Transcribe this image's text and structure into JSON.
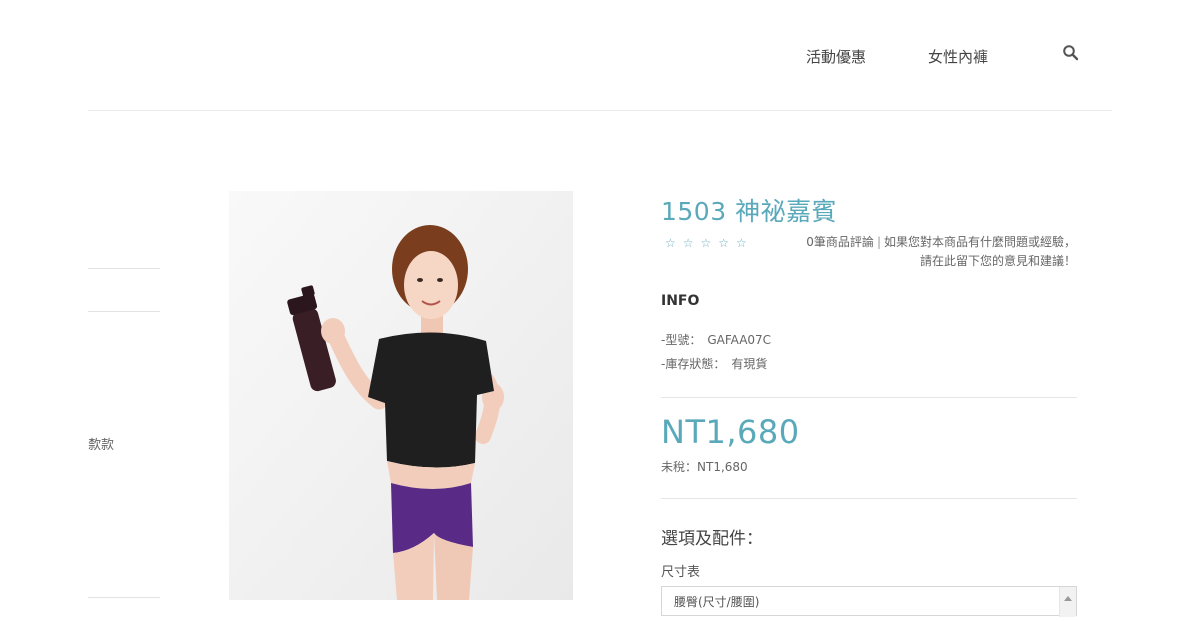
{
  "nav": {
    "items": [
      "活動優惠",
      "女性內褲"
    ]
  },
  "sidebar": {
    "partial_text": "歀款"
  },
  "product": {
    "title": "1503 神祕嘉賓",
    "rating_stars": "☆☆☆☆☆",
    "review_count": "0筆商品評論",
    "review_separator": "|",
    "review_prompt": "如果您對本商品有什麼問題或經驗，請在此留下您的意見和建議！",
    "info_heading": "INFO",
    "model_label": "-型號：",
    "model_value": "GAFAA07C",
    "stock_label": "-庫存狀態：",
    "stock_value": "有現貨",
    "price": "NT1,680",
    "tax_label": "未稅：",
    "tax_value": "NT1,680",
    "options_heading": "選項及配件：",
    "size_chart_label": "尺寸表",
    "size_select_value": "腰臀(尺寸/腰圍)"
  },
  "colors": {
    "accent": "#5aa9bb",
    "text": "#555555",
    "rule": "#e5e5e5"
  }
}
